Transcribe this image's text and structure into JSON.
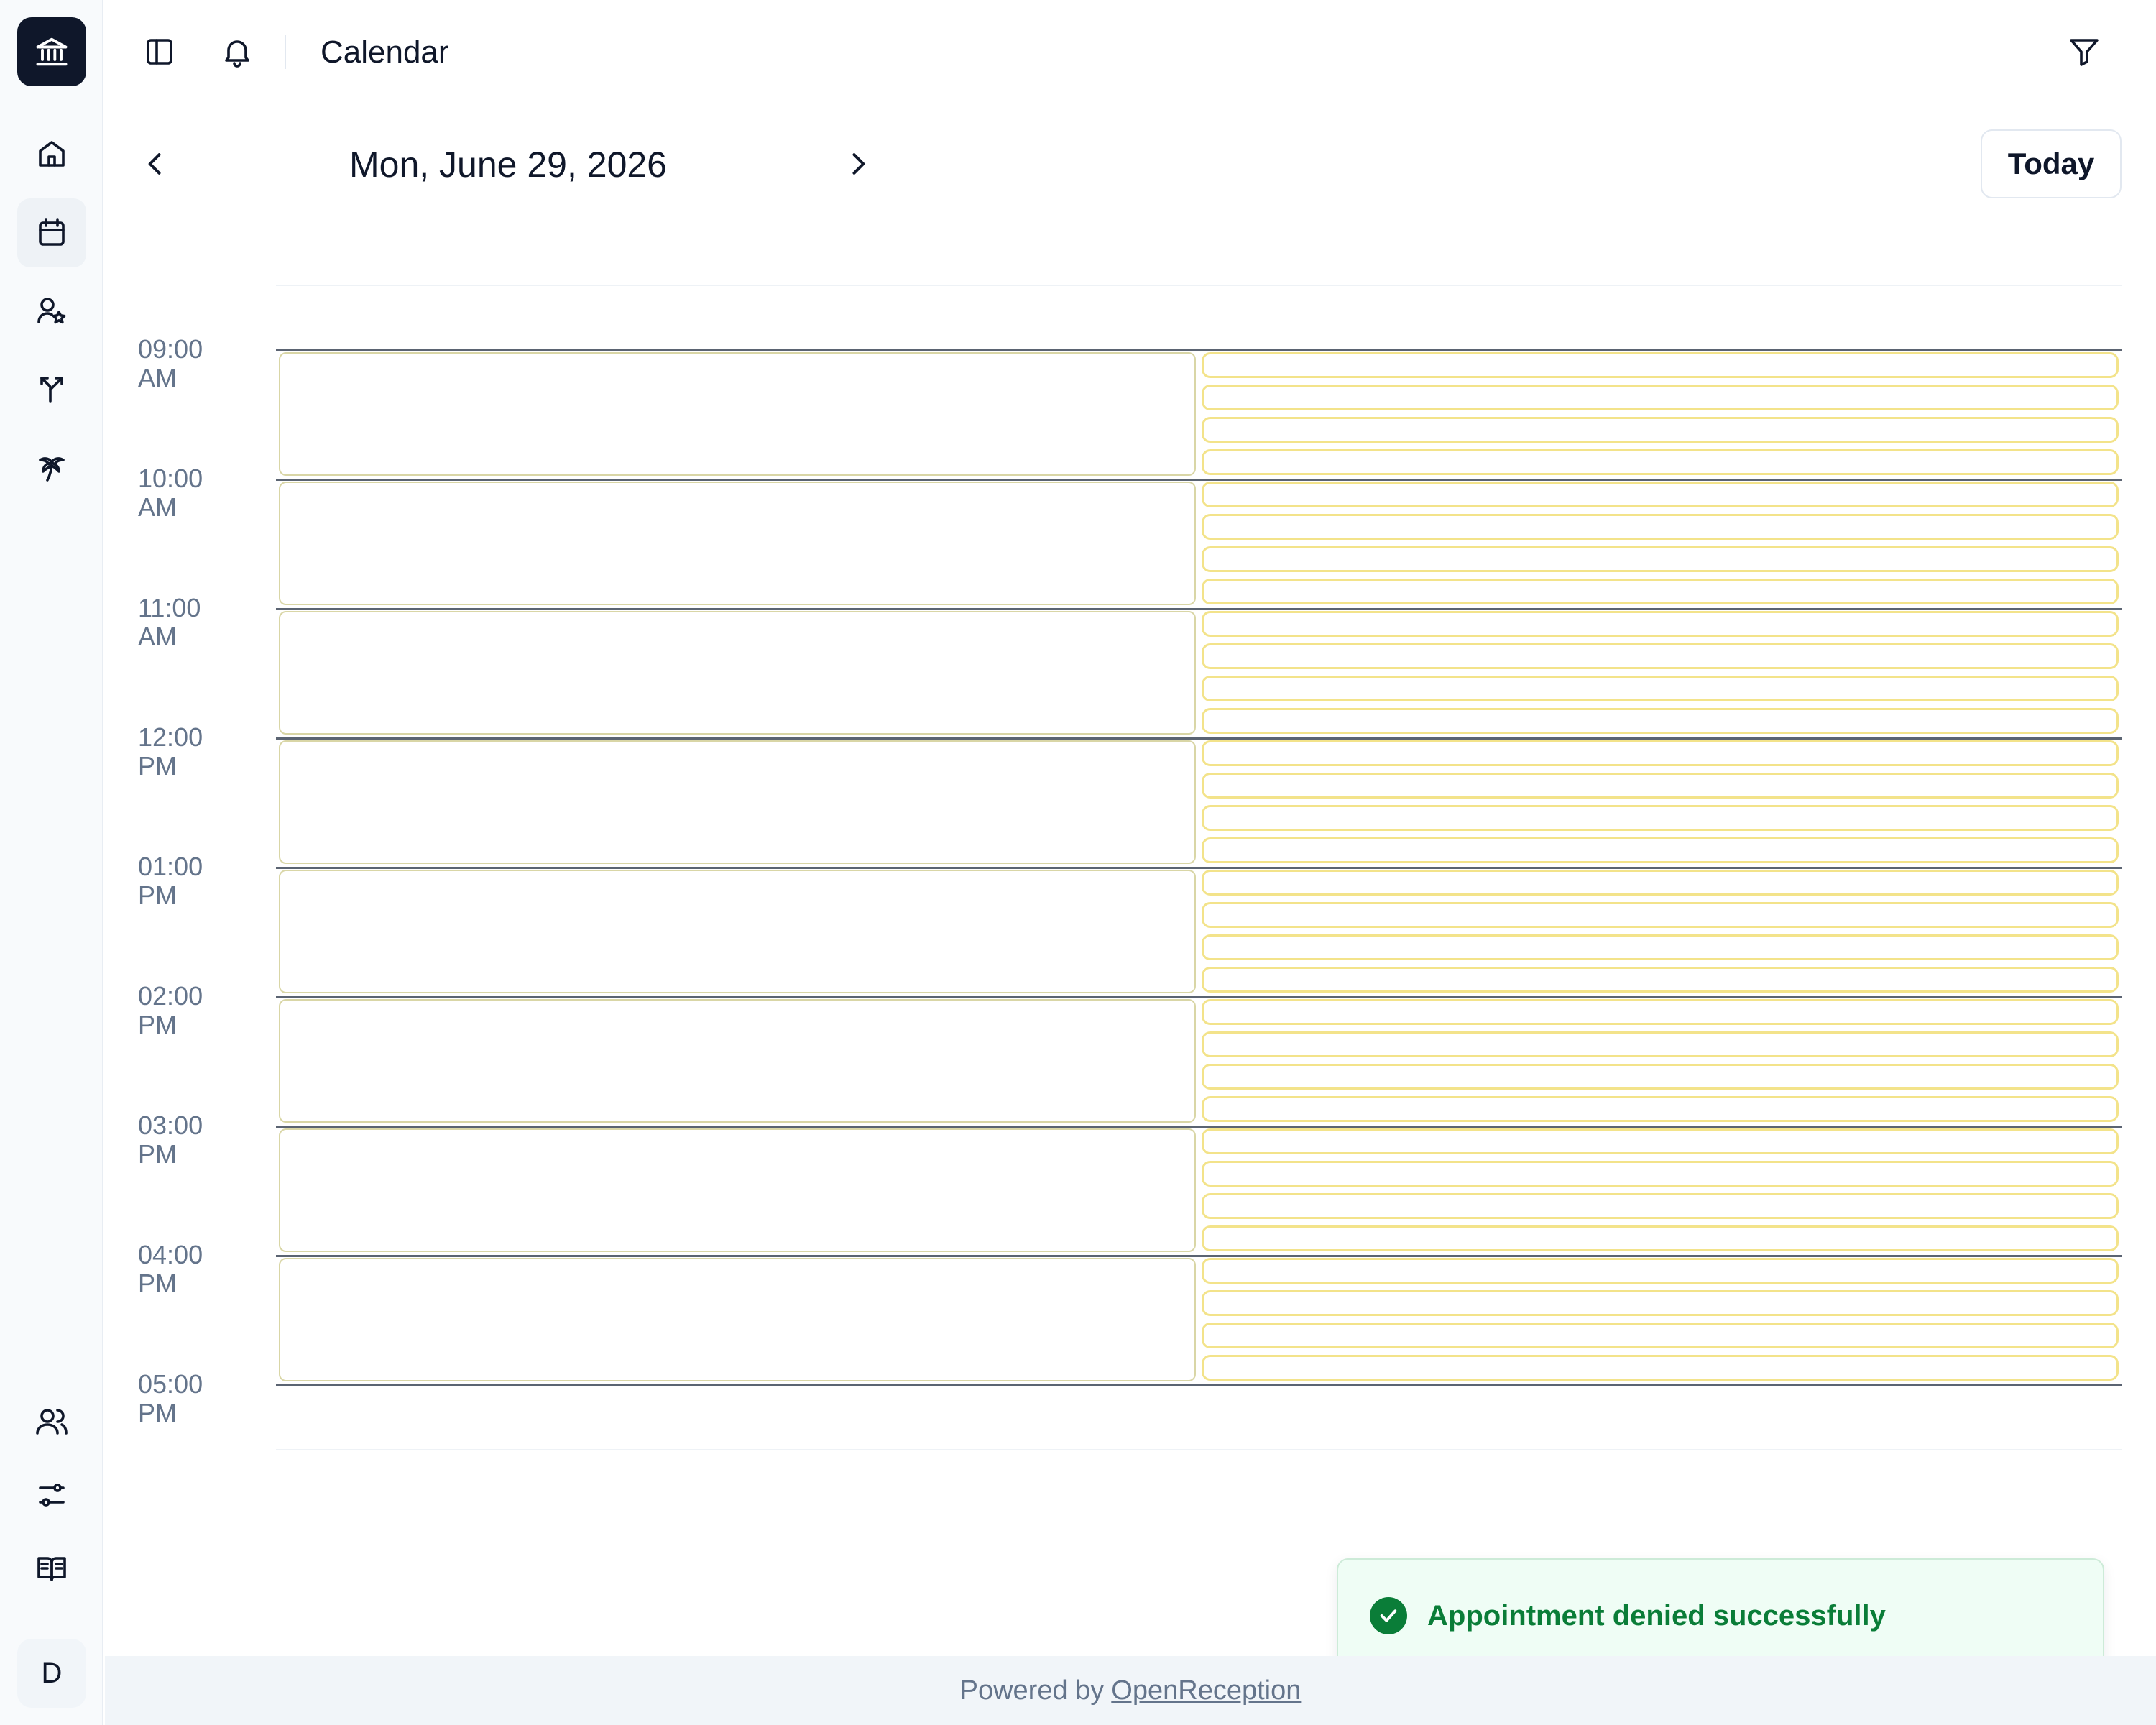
{
  "header": {
    "title": "Calendar",
    "icons": [
      "sidebar-toggle-icon",
      "bell-icon",
      "filter-icon"
    ]
  },
  "sidebar": {
    "logo_icon": "bank-icon",
    "items": [
      {
        "name": "home",
        "icon": "home-icon"
      },
      {
        "name": "calendar",
        "icon": "calendar-icon",
        "active": true
      },
      {
        "name": "favorite-users",
        "icon": "user-star-icon"
      },
      {
        "name": "routing",
        "icon": "split-arrow-icon"
      },
      {
        "name": "holidays",
        "icon": "palm-tree-icon"
      },
      {
        "name": "users",
        "icon": "users-icon"
      },
      {
        "name": "settings",
        "icon": "sliders-icon"
      },
      {
        "name": "docs",
        "icon": "book-icon"
      }
    ],
    "avatar_initial": "D"
  },
  "date_nav": {
    "date": "Mon, June 29, 2026",
    "today_label": "Today"
  },
  "schedule": {
    "times": [
      "09:00 AM",
      "10:00 AM",
      "11:00 AM",
      "12:00 PM",
      "01:00 PM",
      "02:00 PM",
      "03:00 PM",
      "04:00 PM",
      "05:00 PM"
    ],
    "sub_slots_per_hour": 4
  },
  "toast": {
    "message": "Appointment denied successfully"
  },
  "footer": {
    "prefix": "Powered by",
    "link": "OpenReception"
  },
  "colors": {
    "accent": "#0f172a",
    "success": "#0a7d38",
    "slot_border_small": "#f3e38a",
    "slot_border_big": "#d9d6a6"
  }
}
